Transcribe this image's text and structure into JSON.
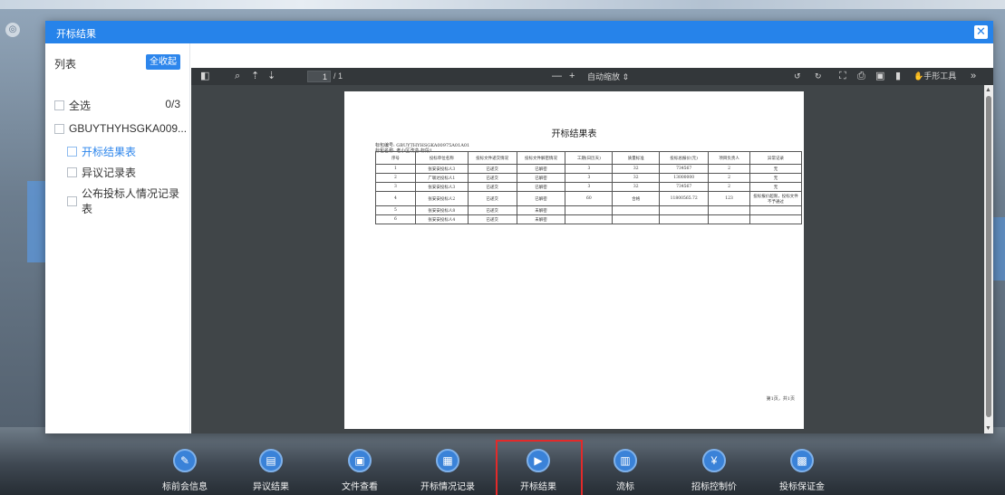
{
  "modal": {
    "title": "开标结果",
    "close_symbol": "✕"
  },
  "left_panel": {
    "title": "列表",
    "collapse_label": "全收起",
    "select_all_label": "全选",
    "count": "0/3",
    "group_label": "GBUYTHYHSGKA009...",
    "items": [
      {
        "label": "开标结果表",
        "active": true
      },
      {
        "label": "异议记录表",
        "active": false
      },
      {
        "label": "公布投标人情况记录表",
        "active": false
      }
    ]
  },
  "viewer": {
    "page_input": "1",
    "page_total": "/ 1",
    "zoom_label": "自动缩放",
    "hand_tool_label": "手形工具"
  },
  "document": {
    "title": "开标结果表",
    "package_no": "标包编号: GBUYTHYHSGKA00975A01A01",
    "package_name": "标包名称: 老小区改造-标段1",
    "columns": [
      "序号",
      "投标单位名称",
      "投标文件递交情况",
      "投标文件解密情况",
      "工期(日历天)",
      "质量标准",
      "投标总报价(元)",
      "项目负责人",
      "异常记录"
    ],
    "rows": [
      [
        "1",
        "张安安投标人3",
        "已递交",
        "已解密",
        "3",
        "32",
        "734567",
        "2",
        "无"
      ],
      [
        "2",
        "广联达投标人1",
        "已递交",
        "已解密",
        "3",
        "32",
        "13000000",
        "2",
        "无"
      ],
      [
        "3",
        "张安安投标人3",
        "已递交",
        "已解密",
        "3",
        "32",
        "734567",
        "2",
        "无"
      ],
      [
        "4",
        "张安安投标人2",
        "已递交",
        "已解密",
        "60",
        "合格",
        "11800565.72",
        "123",
        "投标报价超限，投标文件不予通过"
      ],
      [
        "5",
        "张安安投标人8",
        "已递交",
        "未解密",
        "",
        "",
        "",
        "",
        ""
      ],
      [
        "6",
        "张安安投标人4",
        "已递交",
        "未解密",
        "",
        "",
        "",
        "",
        ""
      ]
    ],
    "footer": "第1页，共1页"
  },
  "bottom_nav": [
    {
      "label": "标前会信息",
      "icon": "edit-icon",
      "glyph": "✎"
    },
    {
      "label": "异议结果",
      "icon": "card-icon",
      "glyph": "▤"
    },
    {
      "label": "文件查看",
      "icon": "file-icon",
      "glyph": "▣"
    },
    {
      "label": "开标情况记录",
      "icon": "record-icon",
      "glyph": "▦"
    },
    {
      "label": "开标结果",
      "icon": "result-icon",
      "glyph": "▶",
      "selected": true
    },
    {
      "label": "流标",
      "icon": "doc-icon",
      "glyph": "▥"
    },
    {
      "label": "招标控制价",
      "icon": "yuan-icon",
      "glyph": "¥"
    },
    {
      "label": "投标保证金",
      "icon": "deposit-icon",
      "glyph": "▩"
    }
  ],
  "colors": {
    "accent": "#2683ea",
    "selected_outline": "#e32a2a"
  }
}
